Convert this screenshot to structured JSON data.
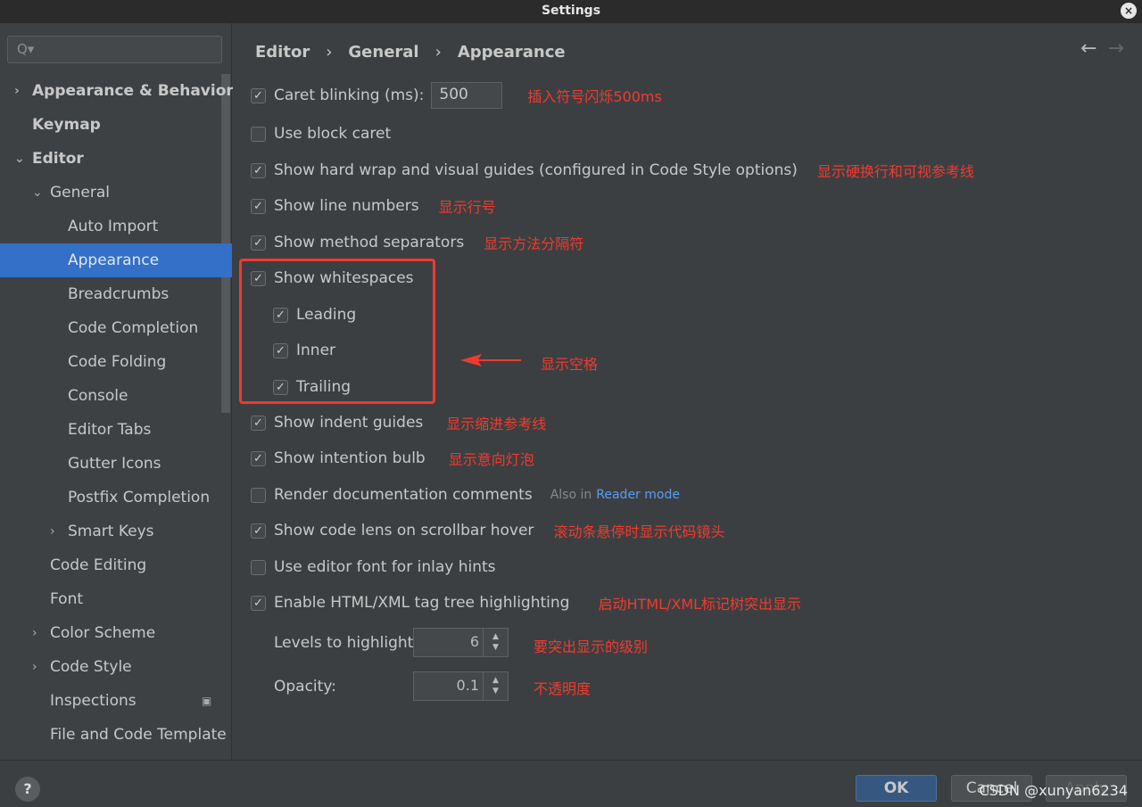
{
  "window": {
    "title": "Settings",
    "close": "×"
  },
  "search": {
    "icon": "search-icon",
    "placeholder": "Q▾"
  },
  "sidebar": {
    "items": [
      {
        "label": "Appearance & Behavior",
        "chevron": "›",
        "indent": 0,
        "bold": true
      },
      {
        "label": "Keymap",
        "indent": 0,
        "bold": true
      },
      {
        "label": "Editor",
        "chevron": "⌄",
        "indent": 0,
        "bold": true
      },
      {
        "label": "General",
        "chevron": "⌄",
        "indent": 1
      },
      {
        "label": "Auto Import",
        "indent": 2
      },
      {
        "label": "Appearance",
        "indent": 2,
        "selected": true
      },
      {
        "label": "Breadcrumbs",
        "indent": 2
      },
      {
        "label": "Code Completion",
        "indent": 2
      },
      {
        "label": "Code Folding",
        "indent": 2
      },
      {
        "label": "Console",
        "indent": 2
      },
      {
        "label": "Editor Tabs",
        "indent": 2
      },
      {
        "label": "Gutter Icons",
        "indent": 2
      },
      {
        "label": "Postfix Completion",
        "indent": 2
      },
      {
        "label": "Smart Keys",
        "chevron": "›",
        "indent": 2
      },
      {
        "label": "Code Editing",
        "indent": 1
      },
      {
        "label": "Font",
        "indent": 1
      },
      {
        "label": "Color Scheme",
        "chevron": "›",
        "indent": 1
      },
      {
        "label": "Code Style",
        "chevron": "›",
        "indent": 1
      },
      {
        "label": "Inspections",
        "indent": 1,
        "badge": "▣"
      },
      {
        "label": "File and Code Template",
        "indent": 1
      }
    ]
  },
  "breadcrumb": [
    "Editor",
    "General",
    "Appearance"
  ],
  "breadcrumb_sep": "›",
  "nav": {
    "back": "←",
    "forward": "→"
  },
  "options": [
    {
      "label": "Caret blinking (ms):",
      "checked": true,
      "value": "500",
      "note": "插入符号闪烁500ms"
    },
    {
      "label": "Use block caret",
      "checked": false
    },
    {
      "label": "Show hard wrap and visual guides (configured in Code Style options)",
      "checked": true,
      "note": "显示硬换行和可视参考线"
    },
    {
      "label": "Show line numbers",
      "checked": true,
      "note": "显示行号"
    },
    {
      "label": "Show method separators",
      "checked": true,
      "note": "显示方法分隔符"
    },
    {
      "label": "Show whitespaces",
      "checked": true
    },
    {
      "label": "Leading",
      "checked": true
    },
    {
      "label": "Inner",
      "checked": true
    },
    {
      "label": "Trailing",
      "checked": true
    },
    {
      "label": "Show indent guides",
      "checked": true,
      "note": "显示缩进参考线"
    },
    {
      "label": "Show intention bulb",
      "checked": true,
      "note": "显示意向灯泡"
    },
    {
      "label": "Render documentation comments",
      "checked": false,
      "also": "Also in",
      "link": "Reader mode"
    },
    {
      "label": "Show code lens on scrollbar hover",
      "checked": true,
      "note": "滚动条悬停时显示代码镜头"
    },
    {
      "label": "Use editor font for inlay hints",
      "checked": false
    },
    {
      "label": "Enable HTML/XML tag tree highlighting",
      "checked": true,
      "note": "启动HTML/XML标记树突出显示"
    }
  ],
  "whitespace_note": "显示空格",
  "levels": {
    "label": "Levels to highlight:",
    "value": "6",
    "note": "要突出显示的级别"
  },
  "opacity": {
    "label": "Opacity:",
    "value": "0.1",
    "note": "不透明度"
  },
  "footer": {
    "help": "?",
    "ok": "OK",
    "cancel": "Cancel",
    "apply": "Apply",
    "watermark": "CSDN @xunyan6234"
  },
  "colors": {
    "accent": "#3470c8",
    "annotation": "#ee3b30",
    "link": "#589df6"
  }
}
